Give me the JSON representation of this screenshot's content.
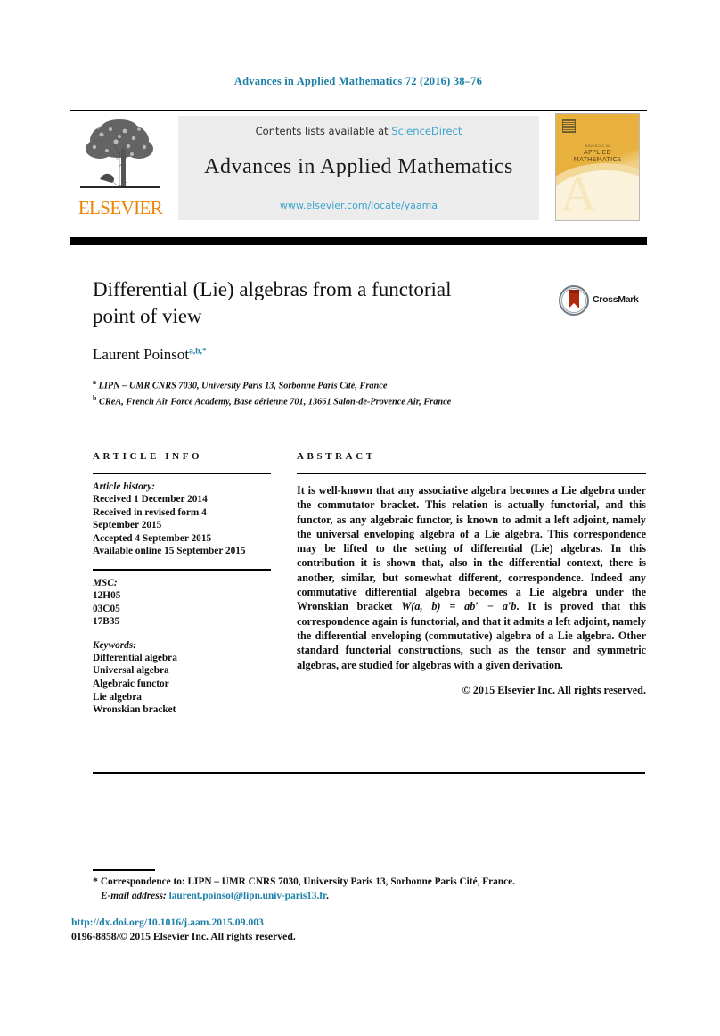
{
  "running_head": "Advances in Applied Mathematics 72 (2016) 38–76",
  "masthead": {
    "contents_prefix": "Contents lists available at ",
    "sciencedirect": "ScienceDirect",
    "journal_title": "Advances in Applied Mathematics",
    "journal_url": "www.elsevier.com/locate/yaama",
    "publisher_logo_text": "ELSEVIER",
    "cover": {
      "superline": "ADVANCES IN",
      "name_line1": "APPLIED",
      "name_line2": "MATHEMATICS",
      "big_letter": "A"
    }
  },
  "article": {
    "title_line1": "Differential (Lie) algebras from a functorial",
    "title_line2": "point of view",
    "crossmark_label": "CrossMark",
    "author": "Laurent Poinsot",
    "author_marks": "a,b,*",
    "affiliations": [
      {
        "mark": "a",
        "text": "LIPN – UMR CNRS 7030, University Paris 13, Sorbonne Paris Cité, France"
      },
      {
        "mark": "b",
        "text": "CReA, French Air Force Academy, Base aérienne 701, 13661 Salon-de-Provence Air, France"
      }
    ]
  },
  "info": {
    "heading": "ARTICLE INFO",
    "history_label": "Article history:",
    "history": [
      "Received 1 December 2014",
      "Received in revised form 4",
      "September 2015",
      "Accepted 4 September 2015",
      "Available online 15 September 2015"
    ],
    "msc_label": "MSC:",
    "msc": [
      "12H05",
      "03C05",
      "17B35"
    ],
    "keywords_label": "Keywords:",
    "keywords": [
      "Differential algebra",
      "Universal algebra",
      "Algebraic functor",
      "Lie algebra",
      "Wronskian bracket"
    ]
  },
  "abstract": {
    "heading": "ABSTRACT",
    "text_part1": "It is well-known that any associative algebra becomes a Lie algebra under the commutator bracket. This relation is actually functorial, and this functor, as any algebraic functor, is known to admit a left adjoint, namely the universal enveloping algebra of a Lie algebra. This correspondence may be lifted to the setting of differential (Lie) algebras. In this contribution it is shown that, also in the differential context, there is another, similar, but somewhat different, correspondence. Indeed any commutative differential algebra becomes a Lie algebra under the Wronskian bracket ",
    "formula1": "W(a, b) = ab′ − a′b",
    "text_part2": ". It is proved that this correspondence again is functorial, and that it admits a left adjoint, namely the differential enveloping (commutative) algebra of a Lie algebra. Other standard functorial constructions, such as the tensor and symmetric algebras, are studied for algebras with a given derivation.",
    "copyright": "© 2015 Elsevier Inc. All rights reserved."
  },
  "footer": {
    "correspondence_star": "*",
    "correspondence": "Correspondence to: LIPN – UMR CNRS 7030, University Paris 13, Sorbonne Paris Cité, France.",
    "email_label": "E-mail address:",
    "email": "laurent.poinsot@lipn.univ-paris13.fr",
    "email_period": ".",
    "doi": "http://dx.doi.org/10.1016/j.aam.2015.09.003",
    "issn_line": "0196-8858/© 2015 Elsevier Inc. All rights reserved."
  },
  "colors": {
    "link": "#1b7fa8",
    "sciencedirect": "#3ba3d0",
    "elsevier_orange": "#ef8200",
    "cover_gold": "#e8b13e",
    "banner_gray": "#ececec"
  }
}
